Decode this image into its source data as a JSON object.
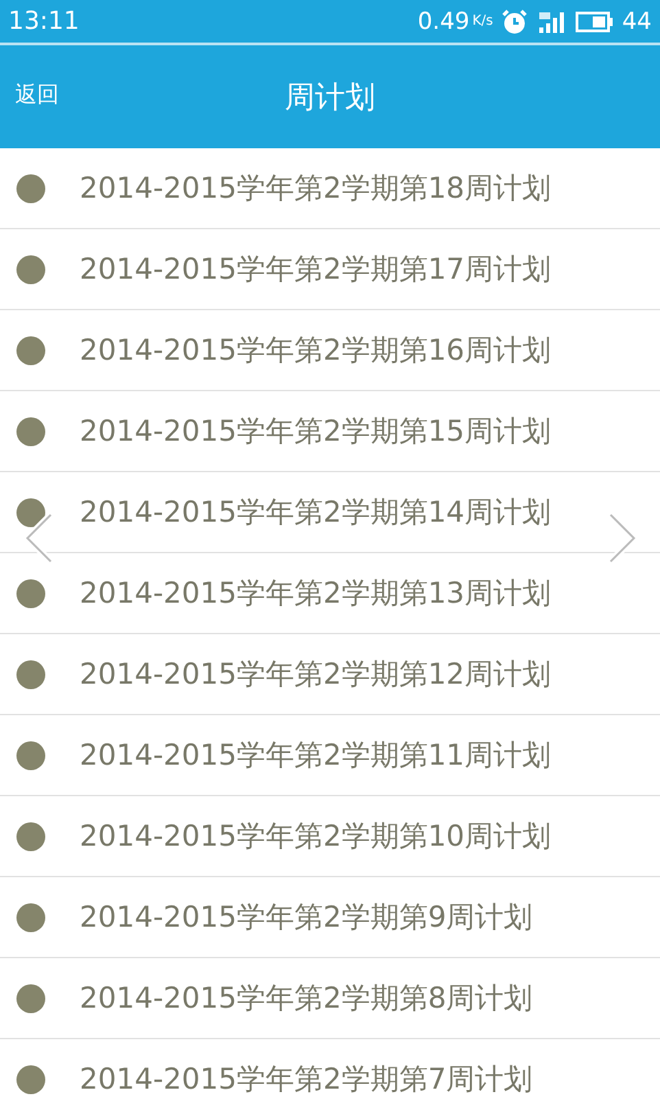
{
  "status_bar": {
    "time": "13:11",
    "speed": "0.49",
    "speed_unit": "K/s",
    "battery": "44"
  },
  "header": {
    "back": "返回",
    "title": "周计划"
  },
  "items": [
    {
      "label": "2014-2015学年第2学期第18周计划"
    },
    {
      "label": "2014-2015学年第2学期第17周计划"
    },
    {
      "label": "2014-2015学年第2学期第16周计划"
    },
    {
      "label": "2014-2015学年第2学期第15周计划"
    },
    {
      "label": "2014-2015学年第2学期第14周计划"
    },
    {
      "label": "2014-2015学年第2学期第13周计划"
    },
    {
      "label": "2014-2015学年第2学期第12周计划"
    },
    {
      "label": "2014-2015学年第2学期第11周计划"
    },
    {
      "label": "2014-2015学年第2学期第10周计划"
    },
    {
      "label": "2014-2015学年第2学期第9周计划"
    },
    {
      "label": "2014-2015学年第2学期第8周计划"
    },
    {
      "label": "2014-2015学年第2学期第7周计划"
    }
  ]
}
